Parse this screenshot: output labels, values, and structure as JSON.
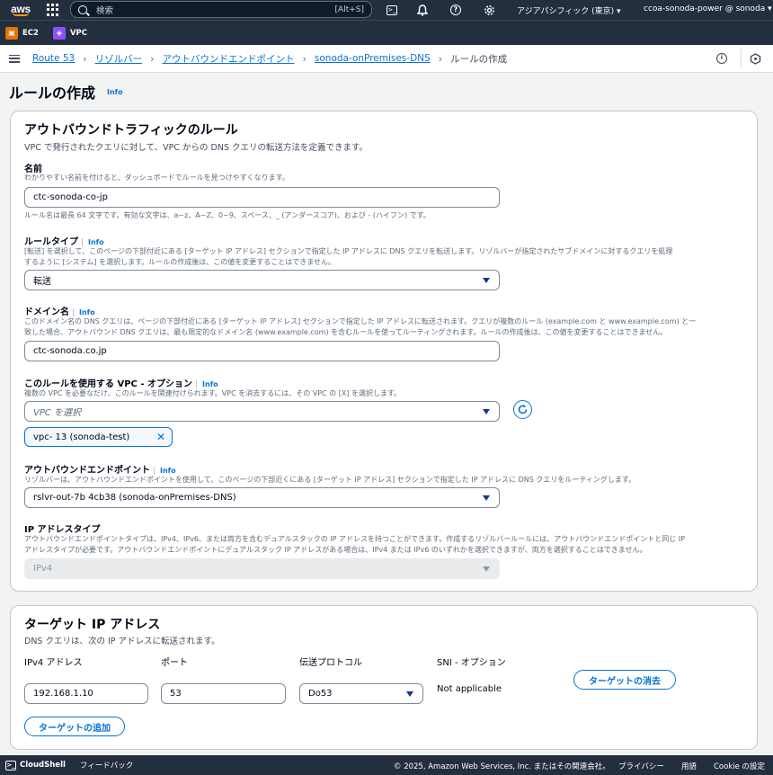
{
  "topnav": {
    "logo": "aws",
    "search_placeholder": "検索",
    "search_shortcut": "[Alt+S]",
    "region": "アジアパシフィック (東京) ▾",
    "account": "ccoa-sonoda-power @ sonoda ▾",
    "icons": [
      "cloudshell-icon",
      "bell-icon",
      "help-icon",
      "gear-icon"
    ]
  },
  "shortcuts": [
    {
      "label": "EC2",
      "color": "#ed7100"
    },
    {
      "label": "VPC",
      "color": "#8c4fff"
    }
  ],
  "breadcrumb": [
    "Route 53",
    "リゾルバー",
    "アウトバウンドエンドポイント",
    "sonoda-onPremises-DNS",
    "ルールの作成"
  ],
  "page": {
    "title": "ルールの作成",
    "info": "Info"
  },
  "rule_panel": {
    "heading": "アウトバウンドトラフィックのルール",
    "description": "VPC で発行されたクエリに対して、VPC からの DNS クエリの転送方法を定義できます。",
    "name": {
      "label": "名前",
      "description": "わかりやすい名前を付けると、ダッシュボードでルールを見つけやすくなります。",
      "value": "ctc-sonoda-co-jp",
      "constraint": "ルール名は最長 64 文字です。有効な文字は、a~z、A~Z、0~9、スペース、_ (アンダースコア)、および - (ハイフン) です。"
    },
    "rule_type": {
      "label": "ルールタイプ",
      "info": "Info",
      "desc_1": "[転送] を選択して、このページの下部付近にある [ターゲット IP アドレス] セクションで指定した IP アドレスに DNS クエリを転送します。リゾルバーが指定されたサブドメインに対するクエリを処理",
      "desc_2": "するように [システム] を選択します。ルールの作成後は、この値を変更することはできません。",
      "value": "転送"
    },
    "domain": {
      "label": "ドメイン名",
      "info": "Info",
      "desc_1": "このドメイン名の DNS クエリは、ページの下部付近にある [ターゲット IP アドレス] セクションで指定した IP アドレスに転送されます。クエリが複数のルール (example.com と www.example.com) と一",
      "desc_2": "致した場合、アウトバウンド DNS クエリは、最も限定的なドメイン名 (www.example.com) を含むルールを使ってルーティングされます。ルールの作成後は、この値を変更することはできません。",
      "value": "ctc-sonoda.co.jp"
    },
    "vpc": {
      "label": "このルールを使用する VPC - オプション",
      "info": "Info",
      "description": "複数の VPC を必要なだけ、このルールを関連付けられます。VPC を消去するには、その VPC の [X] を選択します。",
      "placeholder": "VPC を選択",
      "token": "vpc-            13 (sonoda-test)"
    },
    "endpoint": {
      "label": "アウトバウンドエンドポイント",
      "info": "Info",
      "description": "リゾルバーは、アウトバウンドエンドポイントを使用して、このページの下部近くにある [ターゲット IP アドレス] セクションで指定した IP アドレスに DNS クエリをルーティングします。",
      "value": "rslvr-out-7b                    4cb38 (sonoda-onPremises-DNS)"
    },
    "ip_type": {
      "label": "IP アドレスタイプ",
      "desc_1": "アウトバウンドエンドポイントタイプは、IPv4、IPv6、または両方を含むデュアルスタックの IP アドレスを持つことができます。作成するリゾルバールールには、アウトバウンドエンドポイントと同じ IP",
      "desc_2": "アドレスタイプが必要です。アウトバウンドエンドポイントにデュアルスタック IP アドレスがある場合は、IPv4 または IPv6 のいずれかを選択できますが、両方を選択することはできません。",
      "value": "IPv4"
    }
  },
  "target_panel": {
    "heading": "ターゲット IP アドレス",
    "description": "DNS クエリは、次の IP アドレスに転送されます。",
    "columns": {
      "ip": "IPv4 アドレス",
      "port": "ポート",
      "protocol": "伝送プロトコル",
      "sni": "SNI - オプション"
    },
    "row": {
      "ip": "192.168.1.10",
      "port": "53",
      "protocol": "Do53",
      "sni": "Not applicable"
    },
    "remove_button": "ターゲットの消去",
    "add_button": "ターゲットの追加"
  },
  "footer": {
    "cloudshell": "CloudShell",
    "feedback": "フィードバック",
    "copyright": "© 2025, Amazon Web Services, Inc. またはその関連会社。",
    "privacy": "プライバシー",
    "terms": "用語",
    "cookie": "Cookie の設定"
  }
}
